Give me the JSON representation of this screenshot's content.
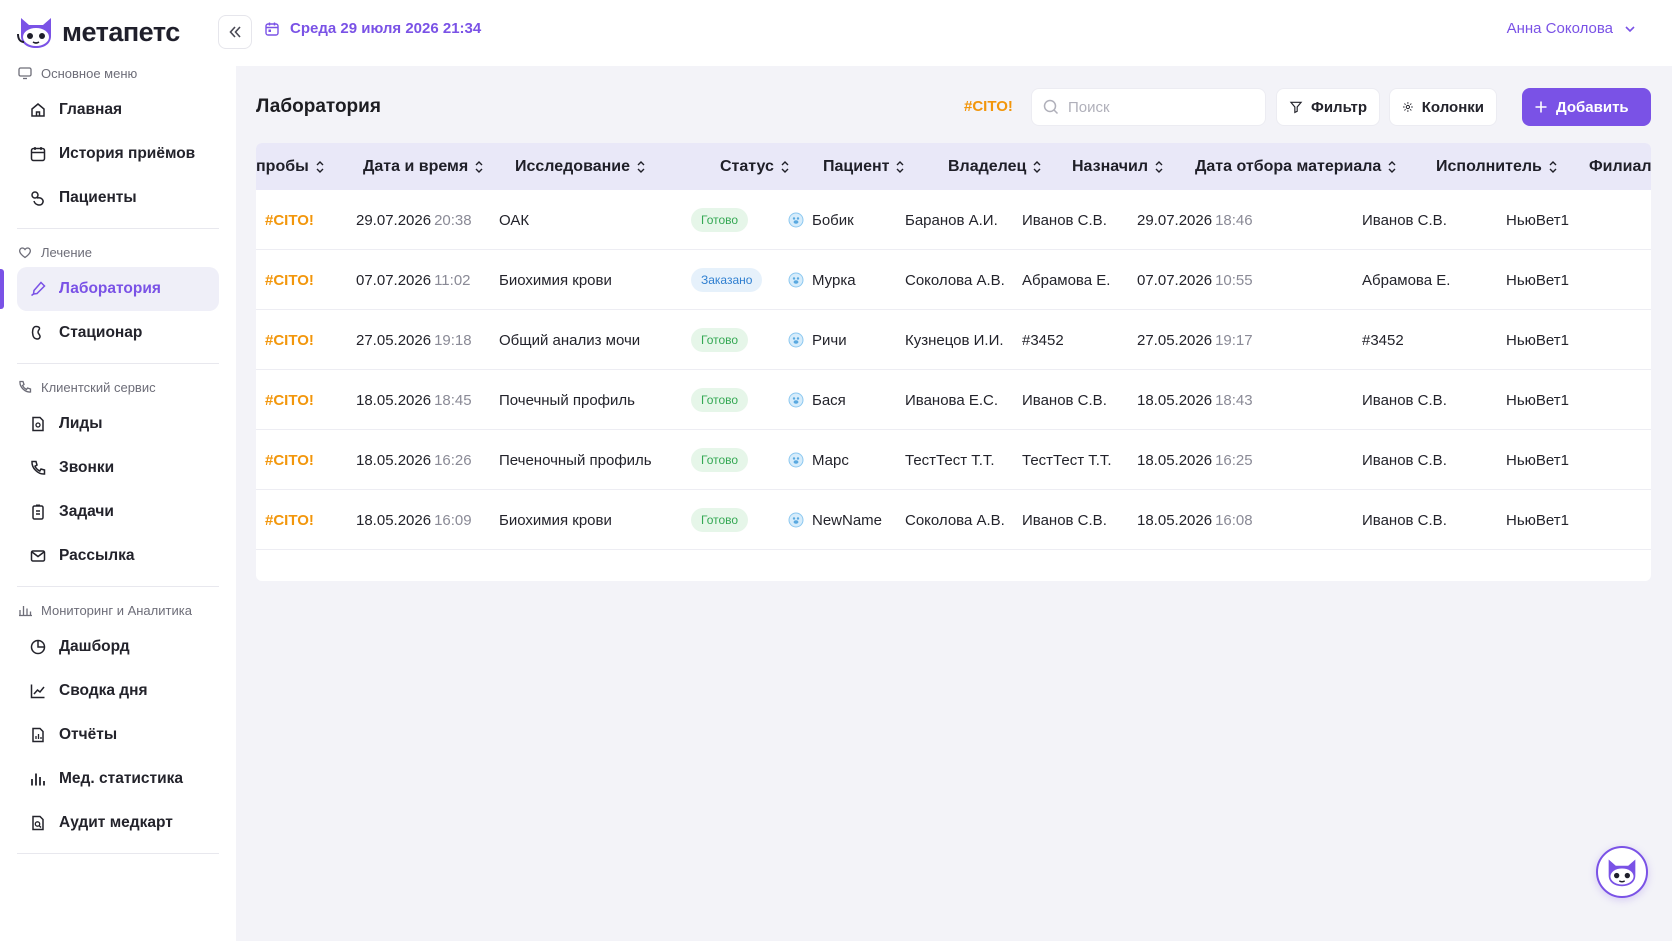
{
  "brand": {
    "name": "метапетс",
    "accent": "#7a52e6"
  },
  "sidebar": {
    "sections": [
      {
        "title": "Основное меню",
        "icon": "monitor-icon",
        "items": [
          {
            "label": "Главная",
            "icon": "home-icon"
          },
          {
            "label": "История приёмов",
            "icon": "calendar-icon"
          },
          {
            "label": "Пациенты",
            "icon": "paw-icon"
          }
        ]
      },
      {
        "title": "Лечение",
        "icon": "heart-icon",
        "items": [
          {
            "label": "Лаборатория",
            "icon": "pipette-icon",
            "active": true
          },
          {
            "label": "Стационар",
            "icon": "kidney-icon"
          }
        ]
      },
      {
        "title": "Клиентский сервис",
        "icon": "phone-icon",
        "items": [
          {
            "label": "Лиды",
            "icon": "document-icon"
          },
          {
            "label": "Звонки",
            "icon": "phone-icon"
          },
          {
            "label": "Задачи",
            "icon": "clipboard-icon"
          },
          {
            "label": "Рассылка",
            "icon": "mail-icon"
          }
        ]
      },
      {
        "title": "Мониторинг и Аналитика",
        "icon": "bar-chart-icon",
        "items": [
          {
            "label": "Дашборд",
            "icon": "pie-icon"
          },
          {
            "label": "Сводка дня",
            "icon": "line-chart-icon"
          },
          {
            "label": "Отчёты",
            "icon": "report-icon"
          },
          {
            "label": "Мед. статистика",
            "icon": "bar-chart-icon"
          },
          {
            "label": "Аудит медкарт",
            "icon": "audit-icon"
          }
        ]
      }
    ]
  },
  "header": {
    "datetime": "Среда 29 июля 2026 21:34",
    "user": "Анна Соколова"
  },
  "page": {
    "title": "Лаборатория",
    "cito_filter": "#CITO!",
    "search_placeholder": "Поиск",
    "filter_label": "Фильтр",
    "columns_label": "Колонки",
    "add_label": "Добавить"
  },
  "table": {
    "columns": [
      "пробы",
      "Дата и время",
      "Исследование",
      "Статус",
      "Пациент",
      "Владелец",
      "Назначил",
      "Дата отбора материала",
      "Исполнитель",
      "Филиал"
    ],
    "rows": [
      {
        "probe": "#CITO!",
        "date": "29.07.2026",
        "time": "20:38",
        "study": "ОАК",
        "status": "Готово",
        "status_type": "done",
        "patient": "Бобик",
        "owner": "Баранов А.И.",
        "assigned": "Иванов С.В.",
        "sample_date": "29.07.2026",
        "sample_time": "18:46",
        "executor": "Иванов С.В.",
        "branch": "НьюВет1"
      },
      {
        "probe": "#CITO!",
        "date": "07.07.2026",
        "time": "11:02",
        "study": "Биохимия крови",
        "status": "Заказано",
        "status_type": "ordered",
        "patient": "Мурка",
        "owner": "Соколова А.В.",
        "assigned": "Абрамова Е.",
        "sample_date": "07.07.2026",
        "sample_time": "10:55",
        "executor": "Абрамова Е.",
        "branch": "НьюВет1"
      },
      {
        "probe": "#CITO!",
        "date": "27.05.2026",
        "time": "19:18",
        "study": "Общий анализ мочи",
        "status": "Готово",
        "status_type": "done",
        "patient": "Ричи",
        "owner": "Кузнецов И.И.",
        "assigned": "#3452",
        "sample_date": "27.05.2026",
        "sample_time": "19:17",
        "executor": "#3452",
        "branch": "НьюВет1"
      },
      {
        "probe": "#CITO!",
        "date": "18.05.2026",
        "time": "18:45",
        "study": "Почечный профиль",
        "status": "Готово",
        "status_type": "done",
        "patient": "Бася",
        "owner": "Иванова Е.С.",
        "assigned": "Иванов С.В.",
        "sample_date": "18.05.2026",
        "sample_time": "18:43",
        "executor": "Иванов С.В.",
        "branch": "НьюВет1"
      },
      {
        "probe": "#CITO!",
        "date": "18.05.2026",
        "time": "16:26",
        "study": "Печеночный профиль",
        "status": "Готово",
        "status_type": "done",
        "patient": "Марс",
        "owner": "ТестТест Т.Т.",
        "assigned": "ТестТест Т.Т.",
        "sample_date": "18.05.2026",
        "sample_time": "16:25",
        "executor": "Иванов С.В.",
        "branch": "НьюВет1"
      },
      {
        "probe": "#CITO!",
        "date": "18.05.2026",
        "time": "16:09",
        "study": "Биохимия крови",
        "status": "Готово",
        "status_type": "done",
        "patient": "NewName",
        "owner": "Соколова А.В.",
        "assigned": "Иванов С.В.",
        "sample_date": "18.05.2026",
        "sample_time": "16:08",
        "executor": "Иванов С.В.",
        "branch": "НьюВет1"
      }
    ]
  },
  "colors": {
    "accent": "#7a52e6",
    "cito": "#f2960b",
    "done": "#34a853",
    "ordered": "#2f7fd0",
    "table_header": "#e9e8f8",
    "background": "#f3f3f8"
  }
}
